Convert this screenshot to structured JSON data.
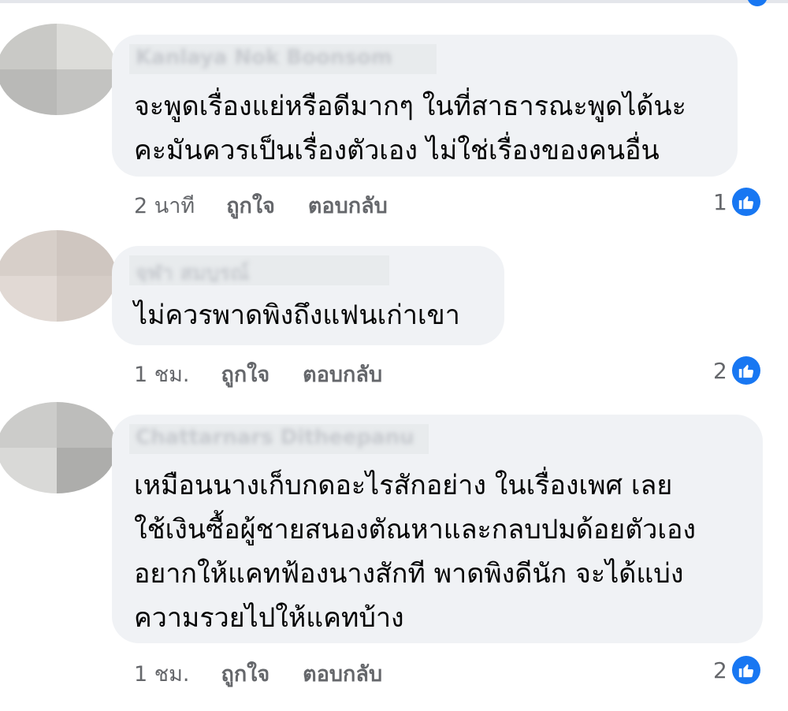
{
  "comments": [
    {
      "author": "Kanlaya Nok Boonsom",
      "text": "จะพูดเรื่องแย่หรือดีมากๆ ในที่สาธารณะพูดได้นะ\nคะมันควรเป็นเรื่องตัวเอง  ไม่ใช่เรื่องของคนอื่น",
      "time": "2 นาที",
      "like_label": "ถูกใจ",
      "reply_label": "ตอบกลับ",
      "like_count": "1"
    },
    {
      "author": "จุฬา สมบูรณ์",
      "text": "ไม่ควรพาดพิงถึงแฟนเก่าเขา",
      "time": "1 ชม.",
      "like_label": "ถูกใจ",
      "reply_label": "ตอบกลับ",
      "like_count": "2"
    },
    {
      "author": "Chattarnars Ditheepanu",
      "text": "เหมือนนางเก็บกดอะไรสักอย่าง ในเรื่องเพศ เลย\nใช้เงินซื้อผู้ชายสนองตัณหาและกลบปมด้อยตัวเอง\nอยากให้แคทฟ้องนางสักที พาดพิงดีนัก จะได้แบ่ง\nความรวยไปให้แคทบ้าง",
      "time": "1 ชม.",
      "like_label": "ถูกใจ",
      "reply_label": "ตอบกลับ",
      "like_count": "2"
    }
  ],
  "colors": {
    "bubble": "#f0f2f5",
    "like_blue": "#1877f2",
    "meta_gray": "#65676b"
  },
  "icons": {
    "like": "thumbs-up-icon"
  }
}
